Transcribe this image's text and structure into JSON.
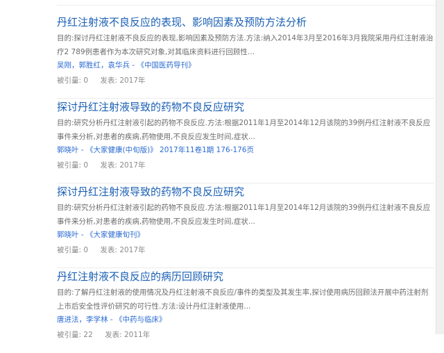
{
  "results": [
    {
      "title": "丹红注射液不良反应的表现、影响因素及预防方法分析",
      "abstract": "目的:探讨丹红注射液不良反应的表现,影响因素及预防方法.方法:纳入2014年3月至2016年3月我院采用丹红注射液治疗2 789例患者作为本次研究对象,对其临床资料进行回顾性...",
      "authors": [
        "吴刚",
        "郭胜红",
        "袁华兵"
      ],
      "source": "《中国医药导刊》",
      "volume": "",
      "citations_label": "被引量:",
      "citations": "0",
      "year_label": "发表:",
      "year": "2017年"
    },
    {
      "title": "探讨丹红注射液导致的药物不良反应研究",
      "abstract": "目的:研究分析丹红注射液引起的药物不良反应.方法:根据2011年1月至2014年12月该院的39例丹红注射液不良反应事件来分析,对患者的疾病,药物使用,不良反应发生时间,症状...",
      "authors": [
        "郭晓叶"
      ],
      "source": "《大家健康(中旬版)》",
      "volume": "2017年11卷1期 176-176页",
      "citations_label": "被引量:",
      "citations": "0",
      "year_label": "发表:",
      "year": "2017年"
    },
    {
      "title": "探讨丹红注射液导致的药物不良反应研究",
      "abstract": "目的:研究分析丹红注射液引起的药物不良反应.方法:根据2011年1月至2014年12月该院的39例丹红注射液不良反应事件来分析,对患者的疾病,药物使用,不良反应发生时间,症状...",
      "authors": [
        "郭晓叶"
      ],
      "source": "《大家健康旬刊》",
      "volume": "",
      "citations_label": "被引量:",
      "citations": "0",
      "year_label": "发表:",
      "year": "2017年"
    },
    {
      "title": "丹红注射液不良反应的病历回顾研究",
      "abstract": "目的:了解丹红注射液的使用情况及丹红注射液不良反应/事件的类型及其发生率,探讨使用病历回顾法开展中药注射剂上市后安全性评价研究的可行性.方法:设计丹红注射液使用...",
      "authors": [
        "唐进法",
        "李学林"
      ],
      "source": "《中药与临床》",
      "volume": "",
      "citations_label": "被引量:",
      "citations": "22",
      "year_label": "发表:",
      "year": "2011年"
    }
  ],
  "colors": {
    "title": "#1a5fb4",
    "link": "#2a6bd1",
    "abstract": "#6c6c6c",
    "meta_gray": "#8a8a8a"
  }
}
